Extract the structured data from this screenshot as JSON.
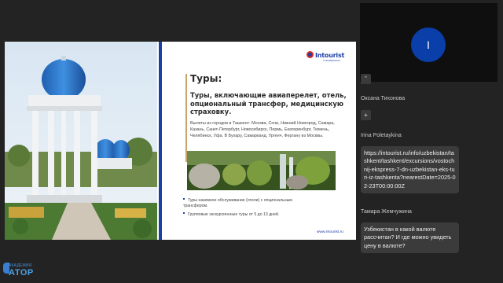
{
  "slide": {
    "logo": "Intourist",
    "logo_sub": "ТУРОПЕРАТОР",
    "title": "Туры:",
    "subtitle": "Туры, включающие авиаперелет, отель, опциональный трансфер, медицинскую страховку.",
    "cities": "Вылеты из городов в Ташкент: Москва, Сочи, Нижний Новгород, Самара, Казань, Санкт-Петербург, Новосибирск, Пермь, Екатеринбург, Тюмень, Челябинск, Уфа. В Бухару, Самарканд, Ургенч, Фергану из Москвы.",
    "bullets": [
      "Туры наземное обслуживание (отели) с опциональным трансфером.",
      "Групповые экскурсионные туры от 5 до 13 дней."
    ],
    "url": "www.intourist.ru"
  },
  "brand": {
    "small": "АКАДЕМИЯ",
    "big": "АТОР"
  },
  "participant": {
    "avatar_letter": "I"
  },
  "chat": {
    "collapsed_symbol": "⌃",
    "plus_symbol": "+",
    "senders": [
      "Оксана Тихонова",
      "Irina Poletaykina",
      "Тамара Жемчужина"
    ],
    "messages": [
      "https://intourist.ru/info/uzbekistan/tashkent/tashkent/excursions/vostochnij-ekspress-7-dn-uzbekistan-eks-turi-iz-tashkenta?nearestDate=2025-02-23T00:00:00Z",
      "Узбекистан в какой валюте рассчитан? И где можно увидеть цену в валюте?"
    ]
  },
  "colors": {
    "accent": "#1c3fa6",
    "avatar": "#0a3ea8",
    "background": "#232323",
    "bubble": "#3b3b3b"
  }
}
